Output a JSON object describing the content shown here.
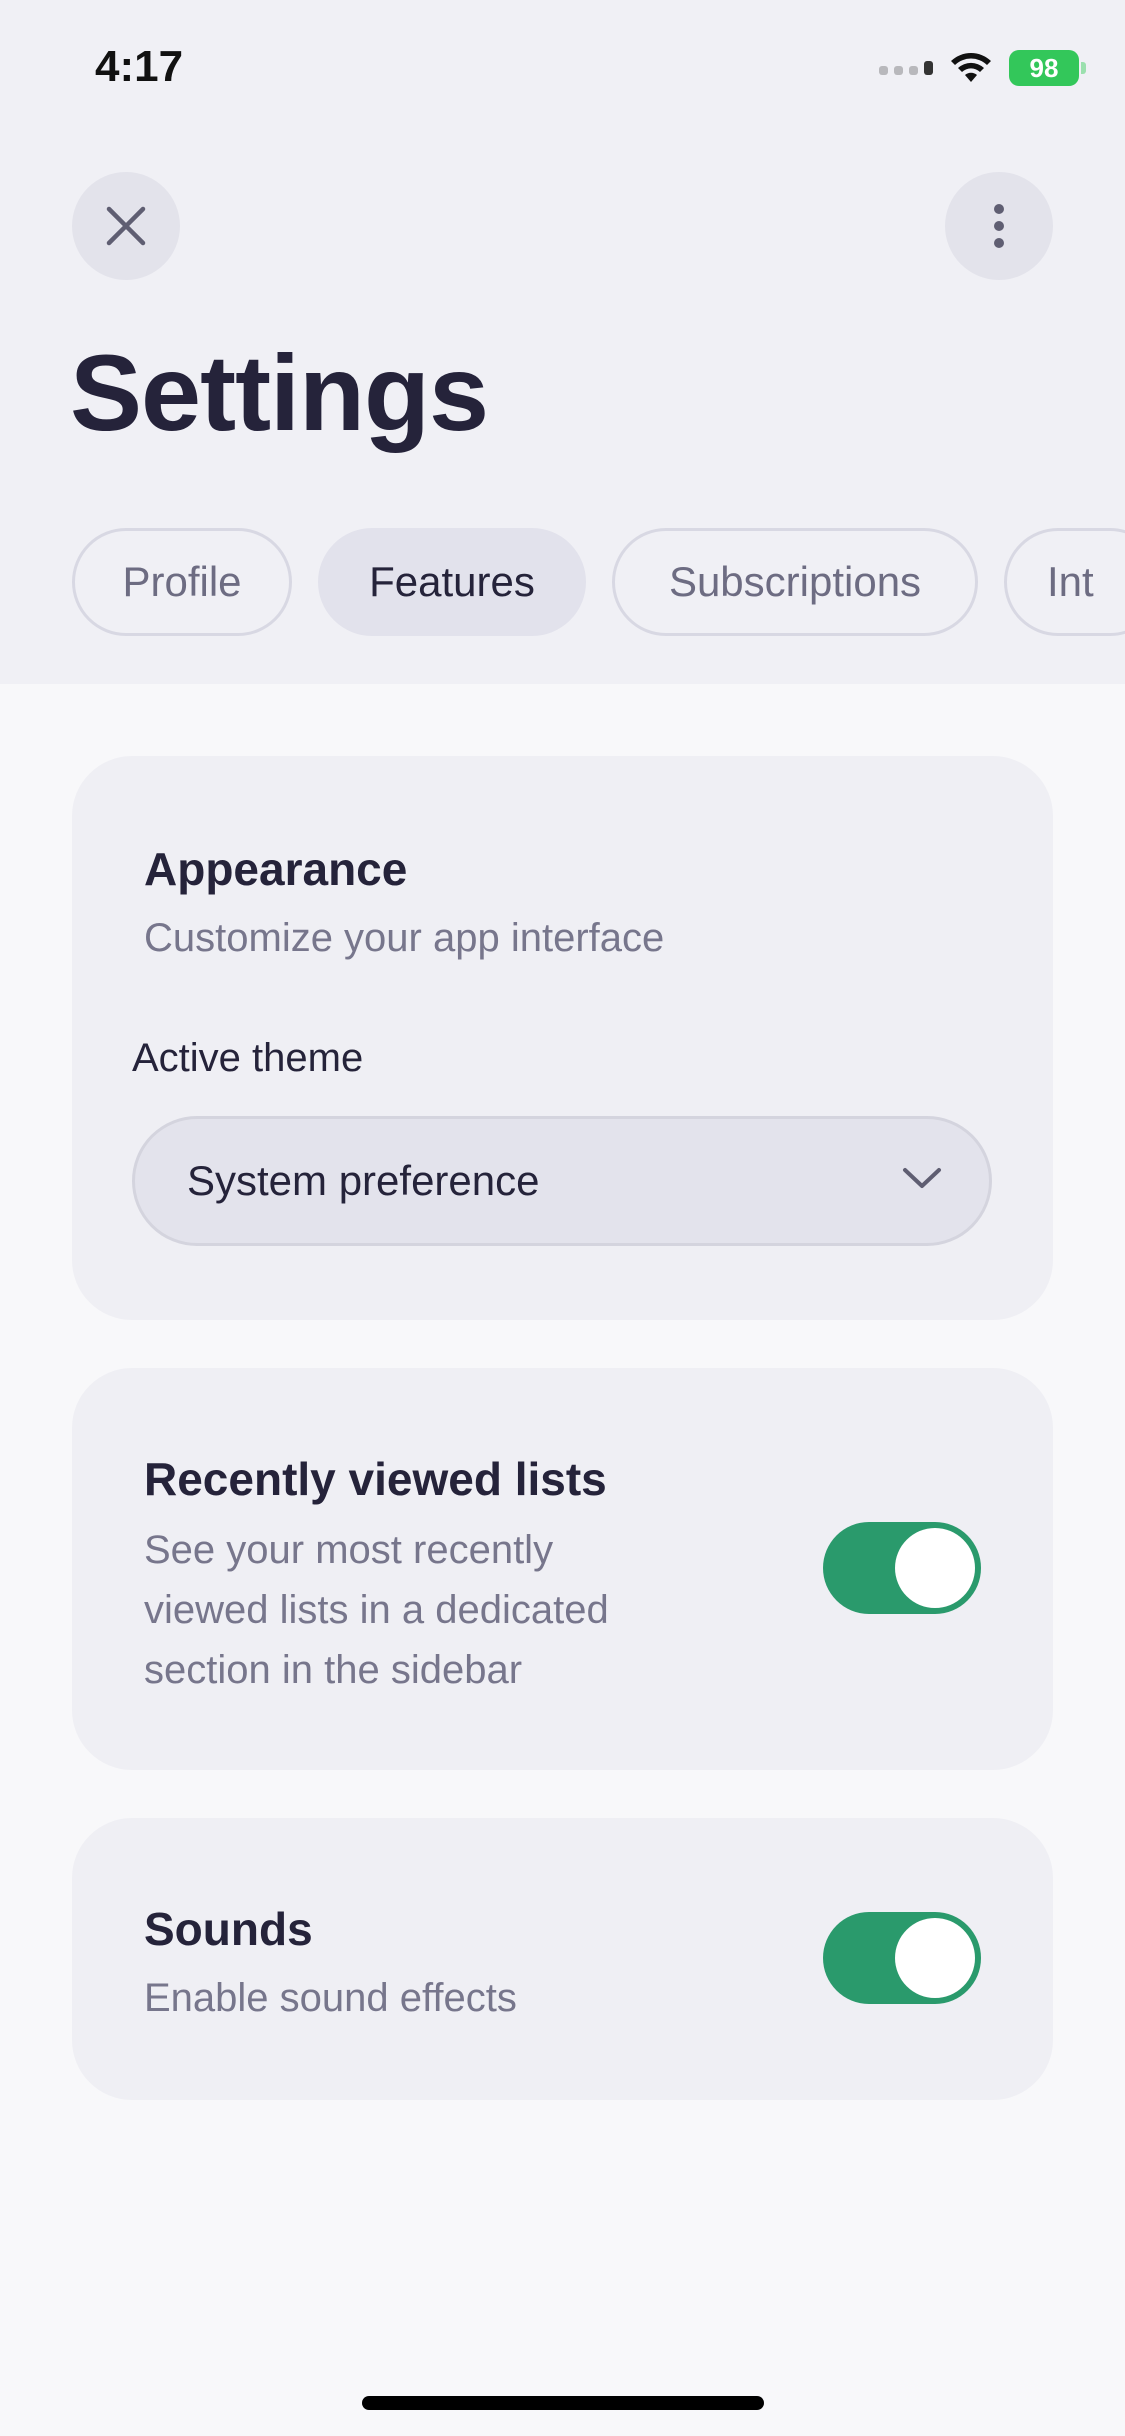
{
  "status": {
    "time": "4:17",
    "battery": "98"
  },
  "header": {
    "title": "Settings",
    "tabs": [
      {
        "label": "Profile"
      },
      {
        "label": "Features"
      },
      {
        "label": "Subscriptions"
      },
      {
        "label": "Int"
      }
    ]
  },
  "appearance": {
    "title": "Appearance",
    "description": "Customize your app interface",
    "theme_label": "Active theme",
    "theme_value": "System preference"
  },
  "recent_lists": {
    "title": "Recently viewed lists",
    "description_lines": [
      "See your most recently",
      "viewed lists in a dedicated",
      "section in the sidebar"
    ],
    "enabled": true
  },
  "sounds": {
    "title": "Sounds",
    "description": "Enable sound effects",
    "enabled": true
  },
  "colors": {
    "toggle_on": "#2a9a6c",
    "battery": "#33c75a",
    "title_text": "#25233a",
    "secondary_text": "#77768c"
  }
}
